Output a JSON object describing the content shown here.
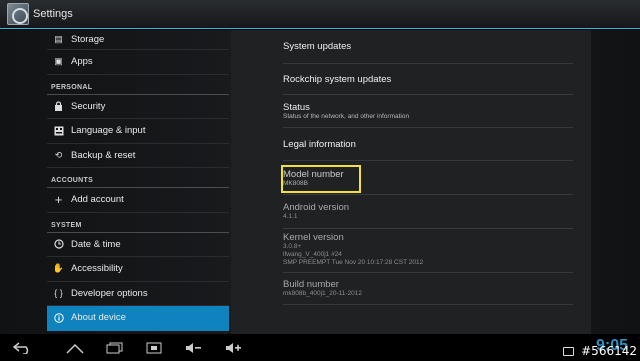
{
  "actionbar": {
    "title": "Settings"
  },
  "sidebar": {
    "items": [
      {
        "type": "header",
        "label": "Storage",
        "icon": "storage-icon"
      },
      {
        "type": "header",
        "label": "Apps",
        "icon": "apps-icon"
      },
      {
        "type": "category",
        "label": "PERSONAL"
      },
      {
        "type": "header",
        "label": "Security",
        "icon": "lock-icon"
      },
      {
        "type": "header",
        "label": "Language & input",
        "icon": "keyboard-icon"
      },
      {
        "type": "header",
        "label": "Backup & reset",
        "icon": "restore-icon"
      },
      {
        "type": "category",
        "label": "ACCOUNTS"
      },
      {
        "type": "header",
        "label": "Add account",
        "icon": "plus-icon"
      },
      {
        "type": "category",
        "label": "SYSTEM"
      },
      {
        "type": "header",
        "label": "Date & time",
        "icon": "clock-icon"
      },
      {
        "type": "header",
        "label": "Accessibility",
        "icon": "hand-icon"
      },
      {
        "type": "header",
        "label": "Developer options",
        "icon": "braces-icon"
      },
      {
        "type": "header",
        "label": "About device",
        "icon": "info-icon",
        "selected": true
      }
    ]
  },
  "about": {
    "system_updates": "System updates",
    "rockchip_updates": "Rockchip system updates",
    "status_title": "Status",
    "status_summary": "Status of the network, and other information",
    "legal": "Legal information",
    "model_title": "Model number",
    "model_value": "MK808B",
    "android_title": "Android version",
    "android_value": "4.1.1",
    "kernel_title": "Kernel version",
    "kernel_line1": "3.0.8+",
    "kernel_line2": "lfwang_V_400j1 #24",
    "kernel_line3": "SMP PREEMPT Tue Nov 20 10:17:28 CST 2012",
    "build_title": "Build number",
    "build_value": "mk808b_400j1_20-11-2012"
  },
  "sysbar": {
    "clock": "9:05"
  },
  "watermark": "#566142",
  "colors": {
    "accent": "#0e83bd",
    "highlight": "#f3e03b",
    "clock": "#2d8fbf"
  }
}
